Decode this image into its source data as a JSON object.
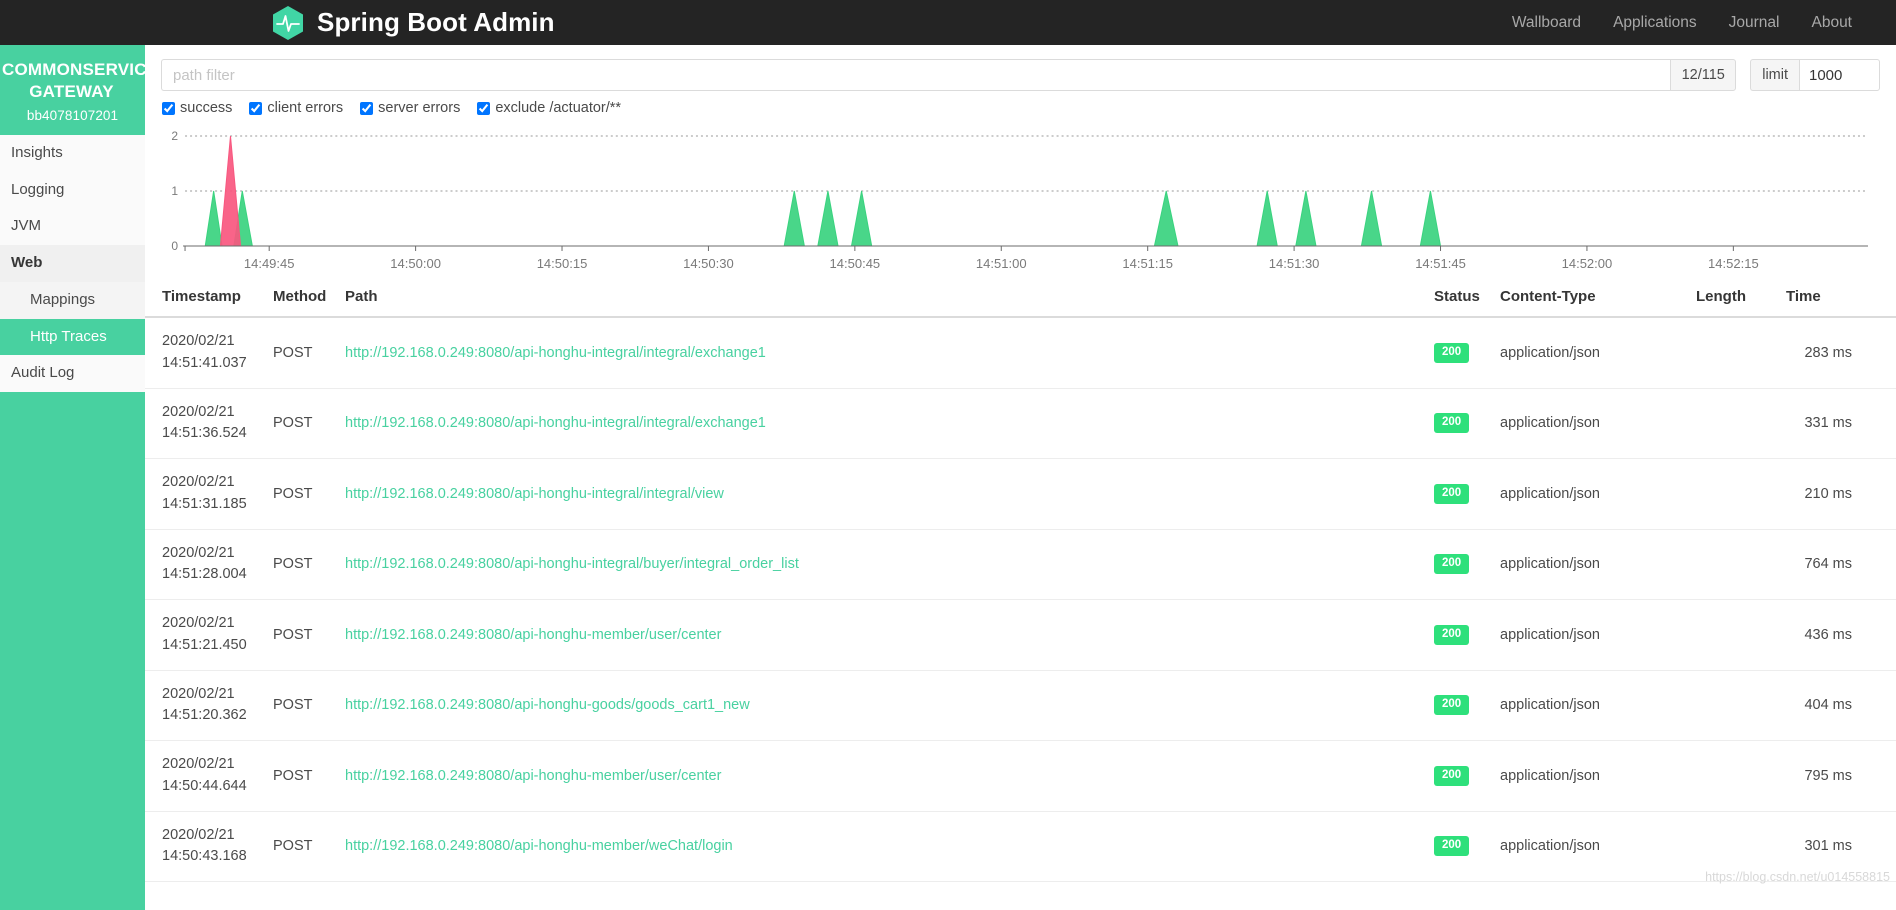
{
  "navbar": {
    "brand_title": "Spring Boot Admin",
    "logo_icon": "heartbeat-hexagon-icon",
    "links": [
      {
        "label": "Wallboard"
      },
      {
        "label": "Applications"
      },
      {
        "label": "Journal"
      },
      {
        "label": "About"
      }
    ]
  },
  "sidebar": {
    "app_name_line1": "COMMONSERVICE",
    "app_name_line2": "GATEWAY",
    "instance_id": "bb4078107201",
    "items": [
      {
        "label": "Insights",
        "type": "item",
        "active": false
      },
      {
        "label": "Logging",
        "type": "item",
        "active": false
      },
      {
        "label": "JVM",
        "type": "item",
        "active": false
      },
      {
        "label": "Web",
        "type": "section",
        "active": false
      },
      {
        "label": "Mappings",
        "type": "sub",
        "active": false
      },
      {
        "label": "Http Traces",
        "type": "sub",
        "active": true
      },
      {
        "label": "Audit Log",
        "type": "item",
        "active": false
      }
    ]
  },
  "filters": {
    "path_filter_placeholder": "path filter",
    "path_filter_value": "",
    "count": "12/115",
    "limit_label": "limit",
    "limit_value": "1000",
    "checkboxes": [
      {
        "label": "success",
        "checked": true
      },
      {
        "label": "client errors",
        "checked": true
      },
      {
        "label": "server errors",
        "checked": true
      },
      {
        "label": "exclude /actuator/**",
        "checked": true
      }
    ]
  },
  "chart_data": {
    "type": "area",
    "title": "",
    "xlabel": "",
    "ylabel": "",
    "ylim": [
      0,
      2
    ],
    "y_ticks": [
      "0",
      "1",
      "2"
    ],
    "grid": true,
    "legend": "none",
    "x_tick_labels": [
      "14:49:45",
      "14:50:00",
      "14:50:15",
      "14:50:30",
      "14:50:45",
      "14:51:00",
      "14:51:15",
      "14:51:30",
      "14:51:45",
      "14:52:00",
      "14:52:15"
    ],
    "x_tick_positions_pct": [
      5.0,
      13.7,
      22.4,
      31.1,
      39.8,
      48.5,
      57.2,
      65.9,
      74.6,
      83.3,
      92.0
    ],
    "series": [
      {
        "name": "success",
        "color": "#3ad37f",
        "points": [
          {
            "x_pct": 1.2,
            "y": 0
          },
          {
            "x_pct": 1.7,
            "y": 1
          },
          {
            "x_pct": 2.2,
            "y": 0
          },
          {
            "x_pct": 2.9,
            "y": 0
          },
          {
            "x_pct": 3.4,
            "y": 1
          },
          {
            "x_pct": 4.0,
            "y": 0
          },
          {
            "x_pct": 35.6,
            "y": 0
          },
          {
            "x_pct": 36.2,
            "y": 1
          },
          {
            "x_pct": 36.8,
            "y": 0
          },
          {
            "x_pct": 37.6,
            "y": 0
          },
          {
            "x_pct": 38.2,
            "y": 1
          },
          {
            "x_pct": 38.8,
            "y": 0
          },
          {
            "x_pct": 39.6,
            "y": 0
          },
          {
            "x_pct": 40.2,
            "y": 1
          },
          {
            "x_pct": 40.8,
            "y": 0
          },
          {
            "x_pct": 57.6,
            "y": 0
          },
          {
            "x_pct": 58.3,
            "y": 1
          },
          {
            "x_pct": 59.0,
            "y": 0
          },
          {
            "x_pct": 63.7,
            "y": 0
          },
          {
            "x_pct": 64.3,
            "y": 1
          },
          {
            "x_pct": 64.9,
            "y": 0
          },
          {
            "x_pct": 66.0,
            "y": 0
          },
          {
            "x_pct": 66.6,
            "y": 1
          },
          {
            "x_pct": 67.2,
            "y": 0
          },
          {
            "x_pct": 69.9,
            "y": 0
          },
          {
            "x_pct": 70.5,
            "y": 1
          },
          {
            "x_pct": 71.1,
            "y": 0
          },
          {
            "x_pct": 73.4,
            "y": 0
          },
          {
            "x_pct": 74.0,
            "y": 1
          },
          {
            "x_pct": 74.6,
            "y": 0
          }
        ]
      },
      {
        "name": "client errors",
        "color": "#f8577f",
        "points": [
          {
            "x_pct": 2.1,
            "y": 0
          },
          {
            "x_pct": 2.7,
            "y": 2
          },
          {
            "x_pct": 3.3,
            "y": 0
          }
        ]
      }
    ]
  },
  "table": {
    "headers": {
      "timestamp": "Timestamp",
      "method": "Method",
      "path": "Path",
      "status": "Status",
      "content_type": "Content-Type",
      "length": "Length",
      "time": "Time"
    },
    "rows": [
      {
        "date": "2020/02/21",
        "time_of_day": "14:51:41.037",
        "method": "POST",
        "path": "http://192.168.0.249:8080/api-honghu-integral/integral/exchange1",
        "status": "200",
        "content_type": "application/json",
        "length": "",
        "time": "283 ms"
      },
      {
        "date": "2020/02/21",
        "time_of_day": "14:51:36.524",
        "method": "POST",
        "path": "http://192.168.0.249:8080/api-honghu-integral/integral/exchange1",
        "status": "200",
        "content_type": "application/json",
        "length": "",
        "time": "331 ms"
      },
      {
        "date": "2020/02/21",
        "time_of_day": "14:51:31.185",
        "method": "POST",
        "path": "http://192.168.0.249:8080/api-honghu-integral/integral/view",
        "status": "200",
        "content_type": "application/json",
        "length": "",
        "time": "210 ms"
      },
      {
        "date": "2020/02/21",
        "time_of_day": "14:51:28.004",
        "method": "POST",
        "path": "http://192.168.0.249:8080/api-honghu-integral/buyer/integral_order_list",
        "status": "200",
        "content_type": "application/json",
        "length": "",
        "time": "764 ms"
      },
      {
        "date": "2020/02/21",
        "time_of_day": "14:51:21.450",
        "method": "POST",
        "path": "http://192.168.0.249:8080/api-honghu-member/user/center",
        "status": "200",
        "content_type": "application/json",
        "length": "",
        "time": "436 ms"
      },
      {
        "date": "2020/02/21",
        "time_of_day": "14:51:20.362",
        "method": "POST",
        "path": "http://192.168.0.249:8080/api-honghu-goods/goods_cart1_new",
        "status": "200",
        "content_type": "application/json",
        "length": "",
        "time": "404 ms"
      },
      {
        "date": "2020/02/21",
        "time_of_day": "14:50:44.644",
        "method": "POST",
        "path": "http://192.168.0.249:8080/api-honghu-member/user/center",
        "status": "200",
        "content_type": "application/json",
        "length": "",
        "time": "795 ms"
      },
      {
        "date": "2020/02/21",
        "time_of_day": "14:50:43.168",
        "method": "POST",
        "path": "http://192.168.0.249:8080/api-honghu-member/weChat/login",
        "status": "200",
        "content_type": "application/json",
        "length": "",
        "time": "301 ms"
      }
    ]
  },
  "watermark": "https://blog.csdn.net/u014558815"
}
